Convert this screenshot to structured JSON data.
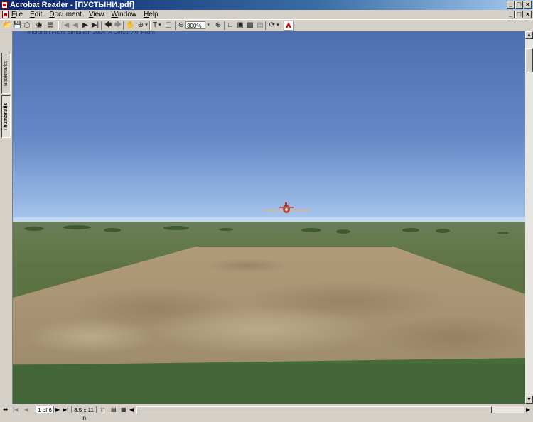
{
  "window": {
    "title": "Acrobat Reader - [ПУСТЫНИ.pdf]",
    "controls": [
      "_",
      "□",
      "×"
    ]
  },
  "menu": {
    "items": [
      "File",
      "Edit",
      "Document",
      "View",
      "Window",
      "Help"
    ]
  },
  "toolbar": {
    "zoom_value": "300%",
    "icons": [
      "open-icon",
      "save-icon",
      "print-icon",
      "find-icon",
      "properties-icon",
      "first-page-icon",
      "previous-page-icon",
      "next-page-icon",
      "last-page-icon",
      "go-back-icon",
      "go-forward-icon",
      "hand-tool-icon",
      "zoom-tool-icon",
      "text-select-icon",
      "graphics-select-icon",
      "zoom-out-icon",
      "zoom-in-icon",
      "actual-size-icon",
      "fit-page-icon",
      "fit-width-icon",
      "reflow-icon",
      "rotate-icon",
      "adobe-logo"
    ]
  },
  "side_tabs": {
    "bookmarks": "Bookmarks",
    "thumbnails": "Thumbnails"
  },
  "status": {
    "page": "1 of 6",
    "page_size": "8.5 x 11 in",
    "hidden_text": "Microsoft Flight Simulator 2004: A Century of Flight"
  },
  "colors": {
    "title_start": "#0a246a",
    "title_end": "#a6caf0",
    "chrome": "#d4d0c8",
    "sky_top": "#4d6fb0",
    "horizon": "#a9c8ee"
  }
}
